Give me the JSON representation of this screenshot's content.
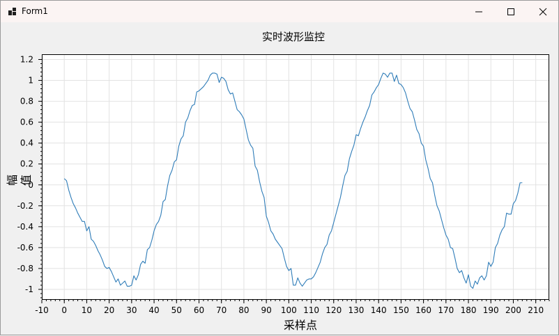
{
  "window": {
    "title": "Form1"
  },
  "chart_data": {
    "type": "line",
    "title": "实时波形监控",
    "xlabel": "采样点",
    "ylabel": "幅值",
    "xlim": [
      -10,
      216
    ],
    "ylim": [
      -1.1,
      1.25
    ],
    "x_ticks": [
      -10,
      0,
      10,
      20,
      30,
      40,
      50,
      60,
      70,
      80,
      90,
      100,
      110,
      120,
      130,
      140,
      150,
      160,
      170,
      180,
      190,
      200,
      210
    ],
    "y_ticks": [
      -1,
      -0.8,
      -0.6,
      -0.4,
      -0.2,
      0,
      0.2,
      0.4,
      0.6,
      0.8,
      1,
      1.2
    ],
    "y_tick_labels": [
      "-1",
      "-0.8",
      "-0.6",
      "-0.4",
      "-0.2",
      "0",
      "0.2",
      "0.4",
      "0.6",
      "0.8",
      "1",
      "1.2"
    ],
    "grid": true,
    "line_color": "#2e7cb8",
    "series": [
      {
        "x_start": 0,
        "x_step": 1,
        "values": [
          0.06,
          0.04,
          -0.05,
          -0.12,
          -0.18,
          -0.22,
          -0.27,
          -0.31,
          -0.35,
          -0.35,
          -0.44,
          -0.4,
          -0.52,
          -0.54,
          -0.58,
          -0.63,
          -0.67,
          -0.72,
          -0.78,
          -0.8,
          -0.79,
          -0.83,
          -0.88,
          -0.93,
          -0.9,
          -0.96,
          -0.94,
          -0.92,
          -0.97,
          -0.97,
          -0.96,
          -0.87,
          -0.91,
          -0.86,
          -0.76,
          -0.73,
          -0.75,
          -0.62,
          -0.6,
          -0.53,
          -0.44,
          -0.38,
          -0.35,
          -0.29,
          -0.16,
          -0.14,
          -0.01,
          0.09,
          0.14,
          0.22,
          0.24,
          0.37,
          0.44,
          0.47,
          0.6,
          0.64,
          0.71,
          0.76,
          0.77,
          0.89,
          0.9,
          0.92,
          0.94,
          0.97,
          1.0,
          1.05,
          1.07,
          1.07,
          1.06,
          0.98,
          1.03,
          1.02,
          0.99,
          0.91,
          0.87,
          0.88,
          0.8,
          0.72,
          0.7,
          0.67,
          0.63,
          0.53,
          0.43,
          0.38,
          0.35,
          0.18,
          0.14,
          0.03,
          -0.06,
          -0.12,
          -0.3,
          -0.36,
          -0.44,
          -0.47,
          -0.52,
          -0.55,
          -0.58,
          -0.61,
          -0.7,
          -0.78,
          -0.82,
          -0.8,
          -0.96,
          -0.96,
          -0.89,
          -0.94,
          -0.97,
          -0.94,
          -0.91,
          -0.9,
          -0.9,
          -0.88,
          -0.84,
          -0.79,
          -0.74,
          -0.66,
          -0.6,
          -0.57,
          -0.48,
          -0.44,
          -0.36,
          -0.28,
          -0.2,
          -0.12,
          -0.01,
          0.09,
          0.13,
          0.25,
          0.32,
          0.38,
          0.48,
          0.47,
          0.54,
          0.6,
          0.65,
          0.71,
          0.76,
          0.86,
          0.89,
          0.93,
          0.96,
          1.02,
          1.07,
          1.06,
          1.03,
          1.07,
          1.07,
          0.99,
          1.05,
          0.97,
          0.96,
          0.93,
          0.88,
          0.8,
          0.73,
          0.7,
          0.62,
          0.53,
          0.49,
          0.4,
          0.37,
          0.24,
          0.16,
          0.06,
          0.02,
          -0.1,
          -0.2,
          -0.25,
          -0.33,
          -0.41,
          -0.48,
          -0.52,
          -0.6,
          -0.61,
          -0.7,
          -0.8,
          -0.84,
          -0.82,
          -0.89,
          -0.94,
          -0.86,
          -0.97,
          -0.99,
          -0.92,
          -0.95,
          -0.89,
          -0.87,
          -0.91,
          -0.87,
          -0.74,
          -0.78,
          -0.74,
          -0.6,
          -0.56,
          -0.48,
          -0.43,
          -0.4,
          -0.27,
          -0.28,
          -0.28,
          -0.18,
          -0.15,
          -0.08,
          0.02,
          0.02
        ]
      }
    ]
  }
}
